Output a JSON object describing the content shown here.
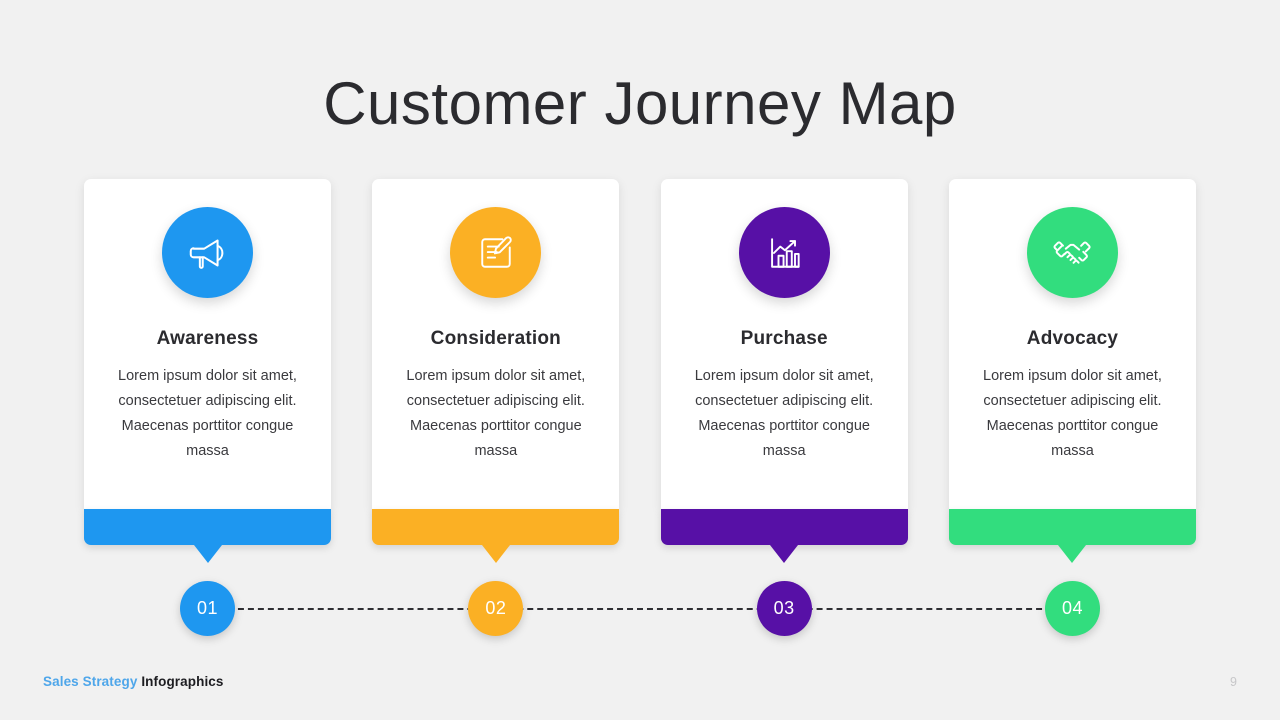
{
  "slide": {
    "title": "Customer Journey Map",
    "background_color": "#f1f1f1",
    "page_number": "9"
  },
  "footer": {
    "brand_primary": "Sales Strategy",
    "brand_primary_color": "#4ea6ea",
    "brand_secondary": "Infographics",
    "brand_secondary_color": "#1d1d21"
  },
  "stages": [
    {
      "number": "01",
      "title": "Awareness",
      "body": "Lorem ipsum dolor sit amet, consectetuer adipiscing elit. Maecenas porttitor congue massa",
      "color": "#1e97f0",
      "icon": "megaphone-icon"
    },
    {
      "number": "02",
      "title": "Consideration",
      "body": "Lorem ipsum dolor sit amet, consectetuer adipiscing elit. Maecenas porttitor congue massa",
      "color": "#fbb024",
      "icon": "note-pencil-icon"
    },
    {
      "number": "03",
      "title": "Purchase",
      "body": "Lorem ipsum dolor sit amet, consectetuer adipiscing elit. Maecenas porttitor congue massa",
      "color": "#5710a6",
      "icon": "bar-chart-growth-icon"
    },
    {
      "number": "04",
      "title": "Advocacy",
      "body": "Lorem ipsum dolor sit amet, consectetuer adipiscing elit. Maecenas porttitor congue massa",
      "color": "#32dd7e",
      "icon": "handshake-icon"
    }
  ]
}
